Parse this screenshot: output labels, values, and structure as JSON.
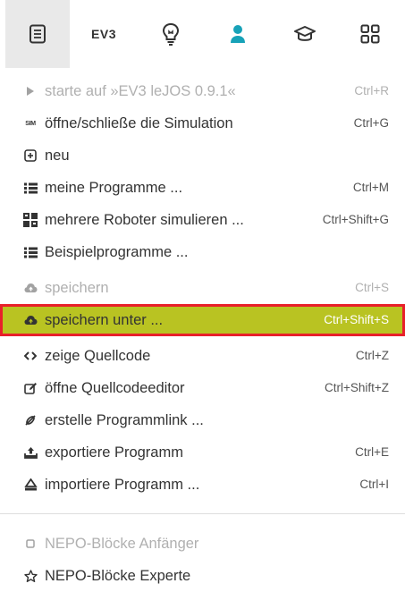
{
  "toolbar": {
    "items": [
      {
        "name": "program-menu",
        "icon": "document-list-icon",
        "active": true
      },
      {
        "name": "robot-menu",
        "icon": "ev3-logo-icon",
        "label": "EV3"
      },
      {
        "name": "help-menu",
        "icon": "lightbulb-icon"
      },
      {
        "name": "user-menu",
        "icon": "user-icon",
        "color": "#17a2b8"
      },
      {
        "name": "gallery-menu",
        "icon": "graduation-cap-icon"
      },
      {
        "name": "apps-menu",
        "icon": "grid-icon"
      }
    ]
  },
  "menu": {
    "items": [
      {
        "icon": "play-icon",
        "label": "starte auf »EV3 leJOS 0.9.1«",
        "shortcut": "Ctrl+R",
        "disabled": true
      },
      {
        "icon": "sim-icon",
        "icon_text": "SIM",
        "label": "öffne/schließe die Simulation",
        "shortcut": "Ctrl+G"
      },
      {
        "icon": "new-document-icon",
        "label": "neu",
        "shortcut": ""
      },
      {
        "icon": "list-icon",
        "label": "meine Programme ...",
        "shortcut": "Ctrl+M"
      },
      {
        "icon": "robots-icon",
        "label": "mehrere Roboter simulieren ...",
        "shortcut": "Ctrl+Shift+G"
      },
      {
        "icon": "list-icon",
        "label": "Beispielprogramme ...",
        "shortcut": ""
      },
      {
        "icon": "cloud-upload-icon",
        "label": "speichern",
        "shortcut": "Ctrl+S",
        "disabled": true
      },
      {
        "icon": "cloud-upload-icon",
        "label": "speichern unter ...",
        "shortcut": "Ctrl+Shift+S",
        "highlighted": true
      },
      {
        "icon": "code-icon",
        "label": "zeige Quellcode",
        "shortcut": "Ctrl+Z"
      },
      {
        "icon": "edit-icon",
        "label": "öffne Quellcodeeditor",
        "shortcut": "Ctrl+Shift+Z"
      },
      {
        "icon": "link-icon",
        "label": "erstelle Programmlink ...",
        "shortcut": ""
      },
      {
        "icon": "export-icon",
        "label": "exportiere Programm",
        "shortcut": "Ctrl+E"
      },
      {
        "icon": "import-icon",
        "label": "importiere Programm ...",
        "shortcut": "Ctrl+I"
      }
    ],
    "block_levels": [
      {
        "icon": "square-outline-icon",
        "label": "NEPO-Blöcke Anfänger",
        "disabled": true
      },
      {
        "icon": "star-outline-icon",
        "label": "NEPO-Blöcke Experte"
      }
    ],
    "highlight_color": "#b9c322",
    "highlight_border_color": "#e8202a"
  }
}
